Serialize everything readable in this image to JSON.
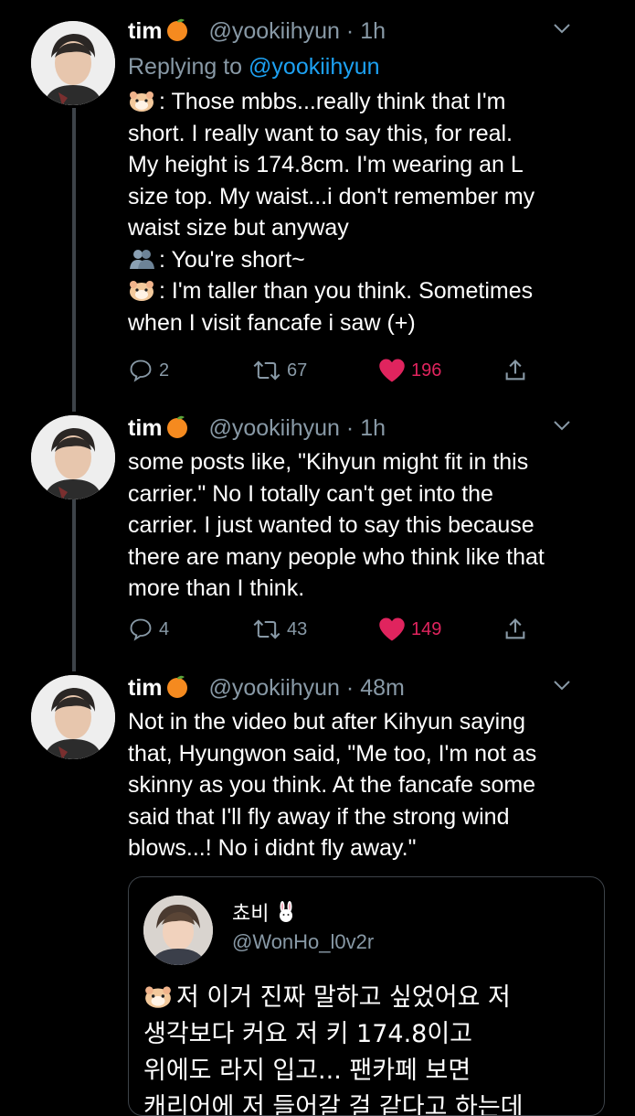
{
  "tweets": [
    {
      "name": "tim",
      "name_emoji": "tangerine-icon",
      "handle": "@yookiihyun",
      "time": "1h",
      "reply_prefix": "Replying to",
      "reply_handle": "@yookiihyun",
      "lines": [
        {
          "emoji": "hamster-icon",
          "text": ": Those mbbs...really think that I'm"
        },
        {
          "text": "short. I really want to say this, for real."
        },
        {
          "text": "My height is 174.8cm. I'm wearing an L"
        },
        {
          "text": "size top. My waist...i don't remember my"
        },
        {
          "text": "waist size but anyway"
        },
        {
          "emoji": "busts-icon",
          "text": ": You're short~"
        },
        {
          "emoji": "hamster-icon",
          "text": ": I'm taller than you think. Sometimes"
        },
        {
          "text": "when I visit fancafe i saw (+)"
        }
      ],
      "replies": "2",
      "retweets": "67",
      "likes": "196",
      "liked": true
    },
    {
      "name": "tim",
      "name_emoji": "tangerine-icon",
      "handle": "@yookiihyun",
      "time": "1h",
      "lines": [
        {
          "text": "some posts like, \"Kihyun might fit in this"
        },
        {
          "text": "carrier.\" No I totally can't get into the"
        },
        {
          "text": "carrier. I just wanted to say this because"
        },
        {
          "text": "there are many people who think like that"
        },
        {
          "text": "more than I think."
        }
      ],
      "replies": "4",
      "retweets": "43",
      "likes": "149",
      "liked": true
    },
    {
      "name": "tim",
      "name_emoji": "tangerine-icon",
      "handle": "@yookiihyun",
      "time": "48m",
      "lines": [
        {
          "text": "Not in the video but after Kihyun saying"
        },
        {
          "text": "that, Hyungwon said, \"Me too, I'm not as"
        },
        {
          "text": "skinny as you think. At the fancafe some"
        },
        {
          "text": "said that I'll fly away if the strong wind"
        },
        {
          "text": "blows...! No i didnt fly away.\""
        }
      ]
    }
  ],
  "quote": {
    "name": "쵸비",
    "name_emoji": "rabbit-icon",
    "handle": "@WonHo_l0v2r",
    "lines": [
      {
        "emoji": "hamster-icon",
        "text": "저 이거 진짜 말하고 싶었어요 저"
      },
      {
        "text": "생각보다 커요 저 키 174.8이고"
      },
      {
        "text": "위에도 라지 입고... 팬카페 보면"
      },
      {
        "text": "캐리어에 저 들어갈 걸 같다고 하는데"
      }
    ]
  },
  "colors": {
    "background": "#000000",
    "text": "#ffffff",
    "secondary": "#8899a6",
    "link": "#1da1f2",
    "like": "#e0245e",
    "border": "#3d4349"
  }
}
